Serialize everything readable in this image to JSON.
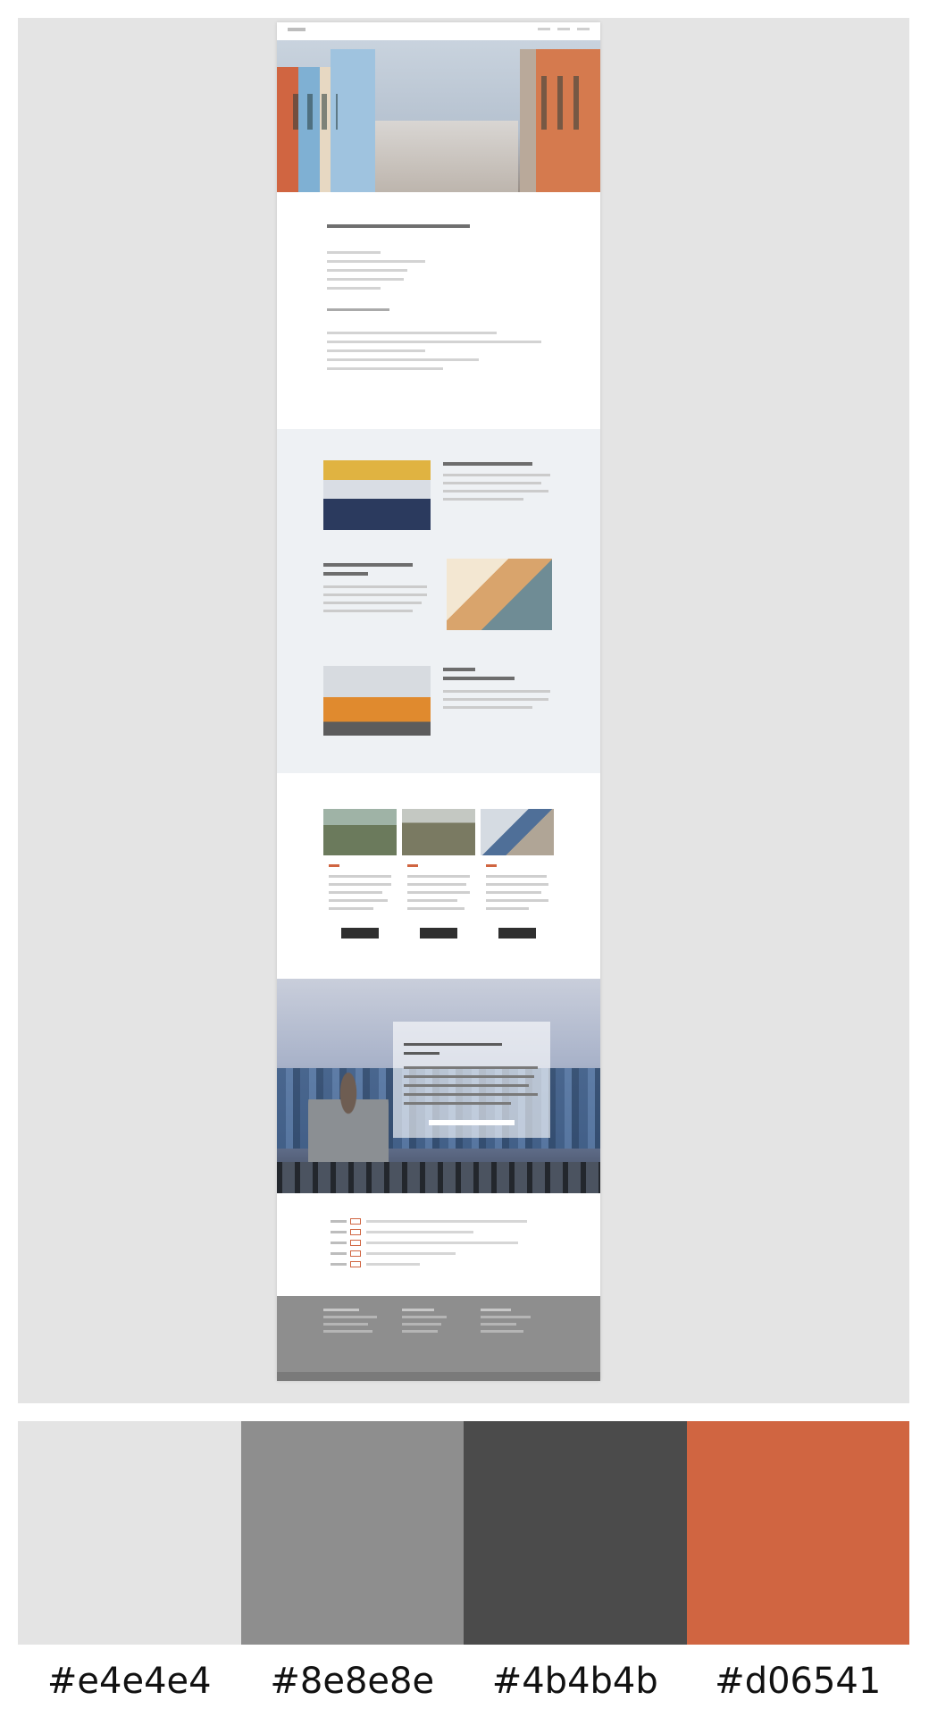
{
  "palette": [
    {
      "hex": "#e4e4e4",
      "label": "#e4e4e4"
    },
    {
      "hex": "#8e8e8e",
      "label": "#8e8e8e"
    },
    {
      "hex": "#4b4b4b",
      "label": "#4b4b4b"
    },
    {
      "hex": "#d06541",
      "label": "#d06541"
    }
  ]
}
